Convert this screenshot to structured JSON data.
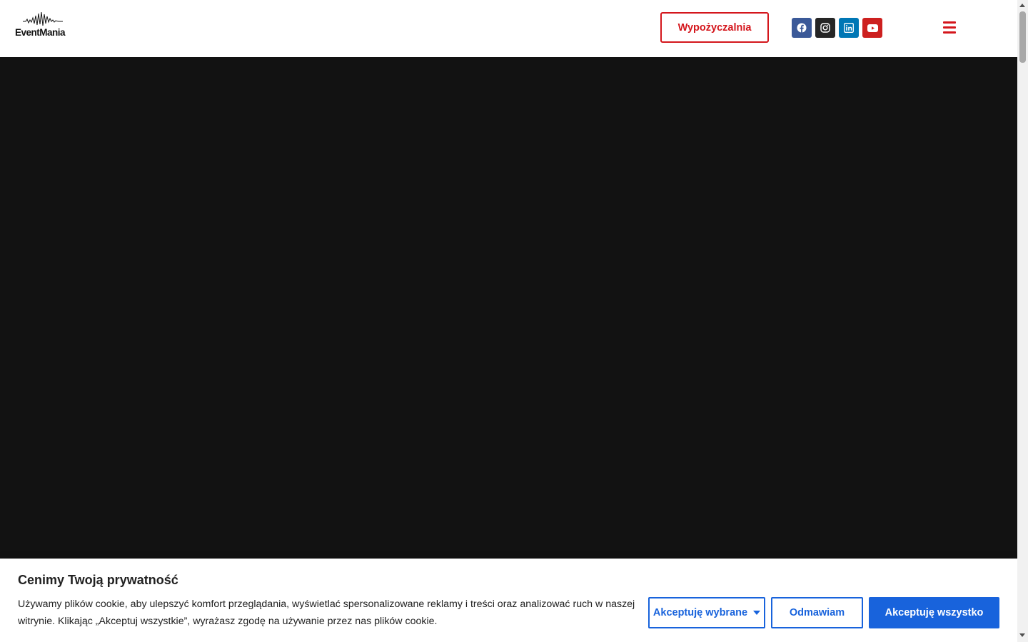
{
  "header": {
    "logo": {
      "text": "EventMania",
      "icon": "soundwave-logo-icon"
    },
    "rental_button_label": "Wypożyczalnia",
    "social_links": [
      {
        "name": "facebook",
        "icon": "facebook-icon",
        "color": "#3b5998"
      },
      {
        "name": "instagram",
        "icon": "instagram-icon",
        "color": "#262626"
      },
      {
        "name": "linkedin",
        "icon": "linkedin-icon",
        "color": "#0077b5"
      },
      {
        "name": "youtube",
        "icon": "youtube-icon",
        "color": "#cd201f"
      }
    ],
    "menu_icon": "hamburger-menu-icon",
    "accent_color": "#d4161c"
  },
  "hero": {
    "background_color": "#121212"
  },
  "cookie_banner": {
    "title": "Cenimy Twoją prywatność",
    "text": "Używamy plików cookie, aby ulepszyć komfort przeglądania, wyświetlać spersonalizowane reklamy i treści oraz analizować ruch w naszej witrynie. Klikając „Akceptuj wszystkie”, wyrażasz zgodę na używanie przez nas plików cookie.",
    "buttons": {
      "accept_selected": "Akceptuję wybrane",
      "reject": "Odmawiam",
      "accept_all": "Akceptuję wszystko"
    },
    "accent_color": "#1863dc"
  }
}
